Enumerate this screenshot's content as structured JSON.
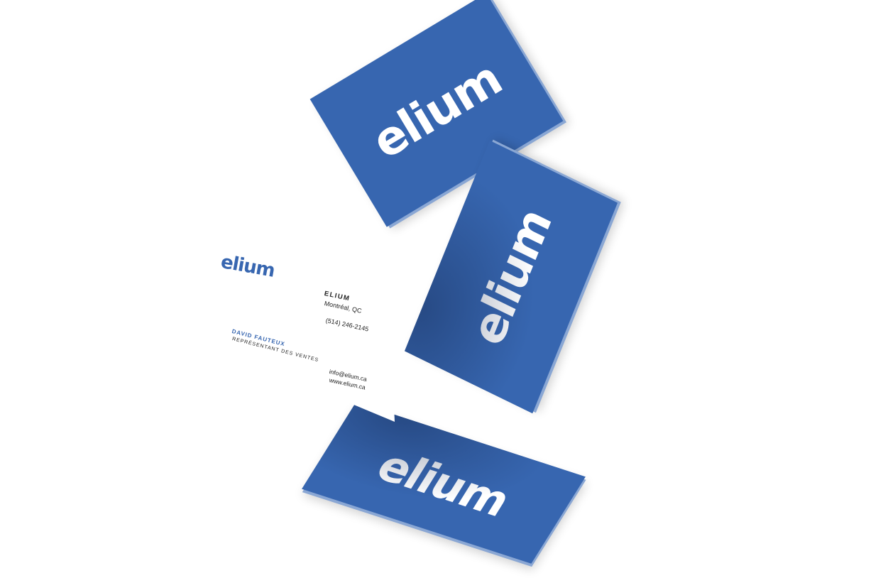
{
  "scene": {
    "brand_color": "#3766b0",
    "background_color": "#ffffff"
  },
  "cards": {
    "top_logo": "elium",
    "middle_logo": "elium",
    "bottom_logo": "elium"
  },
  "white_card": {
    "logo": "elium",
    "company": "ELIUM",
    "city": "Montréal, QC",
    "phone": "(514) 246-2145",
    "person_name": "DAVID FAUTEUX",
    "person_role": "REPRÉSENTANT DES VENTES",
    "email": "info@elium.ca",
    "website": "www.elium.ca"
  }
}
